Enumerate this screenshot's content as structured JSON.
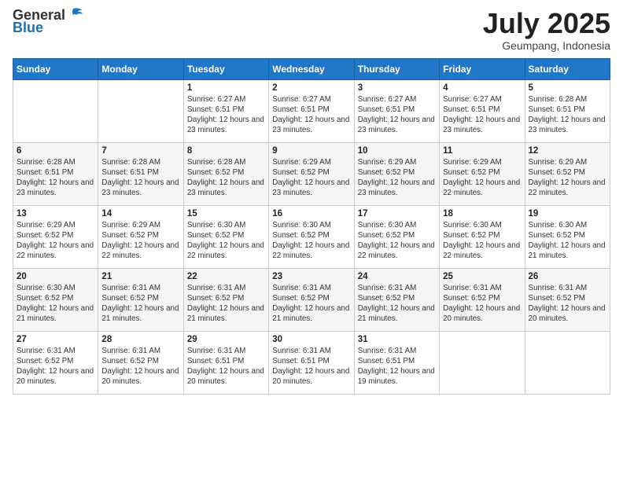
{
  "logo": {
    "text_general": "General",
    "text_blue": "Blue",
    "icon_alt": "GeneralBlue logo"
  },
  "title": {
    "month_year": "July 2025",
    "location": "Geumpang, Indonesia"
  },
  "weekdays": [
    "Sunday",
    "Monday",
    "Tuesday",
    "Wednesday",
    "Thursday",
    "Friday",
    "Saturday"
  ],
  "weeks": [
    [
      {
        "day": "",
        "sunrise": "",
        "sunset": "",
        "daylight": ""
      },
      {
        "day": "",
        "sunrise": "",
        "sunset": "",
        "daylight": ""
      },
      {
        "day": "1",
        "sunrise": "Sunrise: 6:27 AM",
        "sunset": "Sunset: 6:51 PM",
        "daylight": "Daylight: 12 hours and 23 minutes."
      },
      {
        "day": "2",
        "sunrise": "Sunrise: 6:27 AM",
        "sunset": "Sunset: 6:51 PM",
        "daylight": "Daylight: 12 hours and 23 minutes."
      },
      {
        "day": "3",
        "sunrise": "Sunrise: 6:27 AM",
        "sunset": "Sunset: 6:51 PM",
        "daylight": "Daylight: 12 hours and 23 minutes."
      },
      {
        "day": "4",
        "sunrise": "Sunrise: 6:27 AM",
        "sunset": "Sunset: 6:51 PM",
        "daylight": "Daylight: 12 hours and 23 minutes."
      },
      {
        "day": "5",
        "sunrise": "Sunrise: 6:28 AM",
        "sunset": "Sunset: 6:51 PM",
        "daylight": "Daylight: 12 hours and 23 minutes."
      }
    ],
    [
      {
        "day": "6",
        "sunrise": "Sunrise: 6:28 AM",
        "sunset": "Sunset: 6:51 PM",
        "daylight": "Daylight: 12 hours and 23 minutes."
      },
      {
        "day": "7",
        "sunrise": "Sunrise: 6:28 AM",
        "sunset": "Sunset: 6:51 PM",
        "daylight": "Daylight: 12 hours and 23 minutes."
      },
      {
        "day": "8",
        "sunrise": "Sunrise: 6:28 AM",
        "sunset": "Sunset: 6:52 PM",
        "daylight": "Daylight: 12 hours and 23 minutes."
      },
      {
        "day": "9",
        "sunrise": "Sunrise: 6:29 AM",
        "sunset": "Sunset: 6:52 PM",
        "daylight": "Daylight: 12 hours and 23 minutes."
      },
      {
        "day": "10",
        "sunrise": "Sunrise: 6:29 AM",
        "sunset": "Sunset: 6:52 PM",
        "daylight": "Daylight: 12 hours and 23 minutes."
      },
      {
        "day": "11",
        "sunrise": "Sunrise: 6:29 AM",
        "sunset": "Sunset: 6:52 PM",
        "daylight": "Daylight: 12 hours and 22 minutes."
      },
      {
        "day": "12",
        "sunrise": "Sunrise: 6:29 AM",
        "sunset": "Sunset: 6:52 PM",
        "daylight": "Daylight: 12 hours and 22 minutes."
      }
    ],
    [
      {
        "day": "13",
        "sunrise": "Sunrise: 6:29 AM",
        "sunset": "Sunset: 6:52 PM",
        "daylight": "Daylight: 12 hours and 22 minutes."
      },
      {
        "day": "14",
        "sunrise": "Sunrise: 6:29 AM",
        "sunset": "Sunset: 6:52 PM",
        "daylight": "Daylight: 12 hours and 22 minutes."
      },
      {
        "day": "15",
        "sunrise": "Sunrise: 6:30 AM",
        "sunset": "Sunset: 6:52 PM",
        "daylight": "Daylight: 12 hours and 22 minutes."
      },
      {
        "day": "16",
        "sunrise": "Sunrise: 6:30 AM",
        "sunset": "Sunset: 6:52 PM",
        "daylight": "Daylight: 12 hours and 22 minutes."
      },
      {
        "day": "17",
        "sunrise": "Sunrise: 6:30 AM",
        "sunset": "Sunset: 6:52 PM",
        "daylight": "Daylight: 12 hours and 22 minutes."
      },
      {
        "day": "18",
        "sunrise": "Sunrise: 6:30 AM",
        "sunset": "Sunset: 6:52 PM",
        "daylight": "Daylight: 12 hours and 22 minutes."
      },
      {
        "day": "19",
        "sunrise": "Sunrise: 6:30 AM",
        "sunset": "Sunset: 6:52 PM",
        "daylight": "Daylight: 12 hours and 21 minutes."
      }
    ],
    [
      {
        "day": "20",
        "sunrise": "Sunrise: 6:30 AM",
        "sunset": "Sunset: 6:52 PM",
        "daylight": "Daylight: 12 hours and 21 minutes."
      },
      {
        "day": "21",
        "sunrise": "Sunrise: 6:31 AM",
        "sunset": "Sunset: 6:52 PM",
        "daylight": "Daylight: 12 hours and 21 minutes."
      },
      {
        "day": "22",
        "sunrise": "Sunrise: 6:31 AM",
        "sunset": "Sunset: 6:52 PM",
        "daylight": "Daylight: 12 hours and 21 minutes."
      },
      {
        "day": "23",
        "sunrise": "Sunrise: 6:31 AM",
        "sunset": "Sunset: 6:52 PM",
        "daylight": "Daylight: 12 hours and 21 minutes."
      },
      {
        "day": "24",
        "sunrise": "Sunrise: 6:31 AM",
        "sunset": "Sunset: 6:52 PM",
        "daylight": "Daylight: 12 hours and 21 minutes."
      },
      {
        "day": "25",
        "sunrise": "Sunrise: 6:31 AM",
        "sunset": "Sunset: 6:52 PM",
        "daylight": "Daylight: 12 hours and 20 minutes."
      },
      {
        "day": "26",
        "sunrise": "Sunrise: 6:31 AM",
        "sunset": "Sunset: 6:52 PM",
        "daylight": "Daylight: 12 hours and 20 minutes."
      }
    ],
    [
      {
        "day": "27",
        "sunrise": "Sunrise: 6:31 AM",
        "sunset": "Sunset: 6:52 PM",
        "daylight": "Daylight: 12 hours and 20 minutes."
      },
      {
        "day": "28",
        "sunrise": "Sunrise: 6:31 AM",
        "sunset": "Sunset: 6:52 PM",
        "daylight": "Daylight: 12 hours and 20 minutes."
      },
      {
        "day": "29",
        "sunrise": "Sunrise: 6:31 AM",
        "sunset": "Sunset: 6:51 PM",
        "daylight": "Daylight: 12 hours and 20 minutes."
      },
      {
        "day": "30",
        "sunrise": "Sunrise: 6:31 AM",
        "sunset": "Sunset: 6:51 PM",
        "daylight": "Daylight: 12 hours and 20 minutes."
      },
      {
        "day": "31",
        "sunrise": "Sunrise: 6:31 AM",
        "sunset": "Sunset: 6:51 PM",
        "daylight": "Daylight: 12 hours and 19 minutes."
      },
      {
        "day": "",
        "sunrise": "",
        "sunset": "",
        "daylight": ""
      },
      {
        "day": "",
        "sunrise": "",
        "sunset": "",
        "daylight": ""
      }
    ]
  ]
}
